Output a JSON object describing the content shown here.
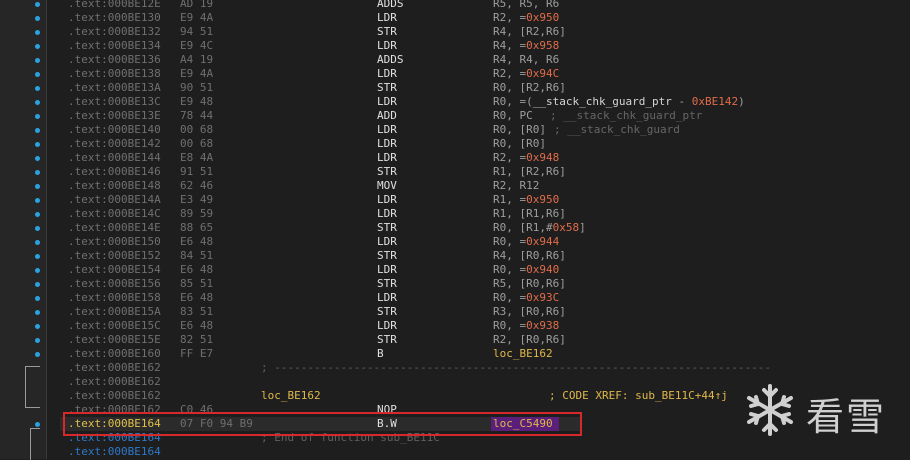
{
  "rows": [
    {
      "addr": ".text:000BE12E",
      "bytes": "AD 19",
      "mn": "ADDS",
      "ops": "R5, R5, R6"
    },
    {
      "addr": ".text:000BE130",
      "bytes": "E9 4A",
      "mn": "LDR",
      "ops_pre": "R2, =",
      "ops_hex": "0x950"
    },
    {
      "addr": ".text:000BE132",
      "bytes": "94 51",
      "mn": "STR",
      "ops": "R4, [R2,R6]"
    },
    {
      "addr": ".text:000BE134",
      "bytes": "E9 4C",
      "mn": "LDR",
      "ops_pre": "R4, =",
      "ops_hex": "0x958"
    },
    {
      "addr": ".text:000BE136",
      "bytes": "A4 19",
      "mn": "ADDS",
      "ops": "R4, R4, R6"
    },
    {
      "addr": ".text:000BE138",
      "bytes": "E9 4A",
      "mn": "LDR",
      "ops_pre": "R2, =",
      "ops_hex": "0x94C"
    },
    {
      "addr": ".text:000BE13A",
      "bytes": "90 51",
      "mn": "STR",
      "ops": "R0, [R2,R6]"
    },
    {
      "addr": ".text:000BE13C",
      "bytes": "E9 48",
      "mn": "LDR",
      "ops_pre": "R0, =(",
      "ops_sym": "__stack_chk_guard_ptr",
      "ops_mid": " - ",
      "ops_hex": "0xBE142",
      "ops_post": ")"
    },
    {
      "addr": ".text:000BE13E",
      "bytes": "78 44",
      "mn": "ADD",
      "ops": "R0, PC",
      "comment": "; __stack_chk_guard_ptr"
    },
    {
      "addr": ".text:000BE140",
      "bytes": "00 68",
      "mn": "LDR",
      "ops": "R0, [R0]",
      "comment": "; __stack_chk_guard"
    },
    {
      "addr": ".text:000BE142",
      "bytes": "00 68",
      "mn": "LDR",
      "ops": "R0, [R0]"
    },
    {
      "addr": ".text:000BE144",
      "bytes": "E8 4A",
      "mn": "LDR",
      "ops_pre": "R2, =",
      "ops_hex": "0x948"
    },
    {
      "addr": ".text:000BE146",
      "bytes": "91 51",
      "mn": "STR",
      "ops": "R1, [R2,R6]"
    },
    {
      "addr": ".text:000BE148",
      "bytes": "62 46",
      "mn": "MOV",
      "ops": "R2, R12"
    },
    {
      "addr": ".text:000BE14A",
      "bytes": "E3 49",
      "mn": "LDR",
      "ops_pre": "R1, =",
      "ops_hex": "0x950"
    },
    {
      "addr": ".text:000BE14C",
      "bytes": "89 59",
      "mn": "LDR",
      "ops": "R1, [R1,R6]"
    },
    {
      "addr": ".text:000BE14E",
      "bytes": "88 65",
      "mn": "STR",
      "ops_pre": "R0, [R1,#",
      "ops_hex": "0x58",
      "ops_post": "]"
    },
    {
      "addr": ".text:000BE150",
      "bytes": "E6 48",
      "mn": "LDR",
      "ops_pre": "R0, =",
      "ops_hex": "0x944"
    },
    {
      "addr": ".text:000BE152",
      "bytes": "84 51",
      "mn": "STR",
      "ops": "R4, [R0,R6]"
    },
    {
      "addr": ".text:000BE154",
      "bytes": "E6 48",
      "mn": "LDR",
      "ops_pre": "R0, =",
      "ops_hex": "0x940"
    },
    {
      "addr": ".text:000BE156",
      "bytes": "85 51",
      "mn": "STR",
      "ops": "R5, [R0,R6]"
    },
    {
      "addr": ".text:000BE158",
      "bytes": "E6 48",
      "mn": "LDR",
      "ops_pre": "R0, =",
      "ops_hex": "0x93C"
    },
    {
      "addr": ".text:000BE15A",
      "bytes": "83 51",
      "mn": "STR",
      "ops": "R3, [R0,R6]"
    },
    {
      "addr": ".text:000BE15C",
      "bytes": "E6 48",
      "mn": "LDR",
      "ops_pre": "R0, =",
      "ops_hex": "0x938"
    },
    {
      "addr": ".text:000BE15E",
      "bytes": "82 51",
      "mn": "STR",
      "ops": "R2, [R0,R6]"
    },
    {
      "addr": ".text:000BE160",
      "bytes": "FF E7",
      "mn": "B",
      "ops_loc": "loc_BE162"
    },
    {
      "addr": ".text:000BE162",
      "separator": "; ---------------------------------------------------------------------------"
    },
    {
      "addr": ".text:000BE162"
    },
    {
      "addr": ".text:000BE162",
      "label": "loc_BE162",
      "xref": "; CODE XREF: sub_BE11C+44↑j"
    },
    {
      "addr": ".text:000BE162",
      "bytes": "C0 46",
      "mn": "NOP"
    },
    {
      "addr": ".text:000BE164",
      "bytes": "07 F0 94 B9",
      "mn": "B.W",
      "ops_loc": "loc_C5490",
      "selected": true
    },
    {
      "addr": ".text:000BE164",
      "comment_only": "; End of function sub_BE11C",
      "blue": true
    },
    {
      "addr": ".text:000BE164",
      "blue": true
    }
  ],
  "watermark": {
    "text": "看雪",
    "icon": "snowflake-icon"
  },
  "colors": {
    "hex": "#e06c4b",
    "label": "#e0b84a",
    "selection_box": "#d62a2a",
    "gutter_dot": "#29a3e0",
    "address_blue": "#2f78c8"
  }
}
